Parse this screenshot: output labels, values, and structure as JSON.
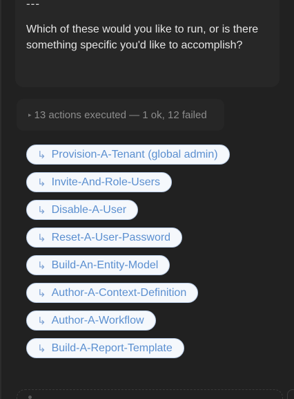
{
  "message": {
    "separator": "---",
    "body": "Which of these would you like to run, or is there something specific you'd like to accomplish?"
  },
  "actions_summary": {
    "caret_icon": "caret-right-icon",
    "label": "13 actions executed — 1 ok, 12 failed"
  },
  "suggestions": {
    "arrow_icon": "return-arrow-icon",
    "arrow_glyph": "↳",
    "items": [
      {
        "label": "Provision-A-Tenant (global admin)"
      },
      {
        "label": "Invite-And-Role-Users"
      },
      {
        "label": "Disable-A-User"
      },
      {
        "label": "Reset-A-User-Password"
      },
      {
        "label": "Build-An-Entity-Model"
      },
      {
        "label": "Author-A-Context-Definition"
      },
      {
        "label": "Author-A-Workflow"
      },
      {
        "label": "Build-A-Report-Template"
      }
    ]
  },
  "colors": {
    "background": "#212121",
    "card": "#272727",
    "chip_background": "#f5f8fc",
    "chip_border": "#b9cce6",
    "chip_text": "#5b8fd0"
  }
}
